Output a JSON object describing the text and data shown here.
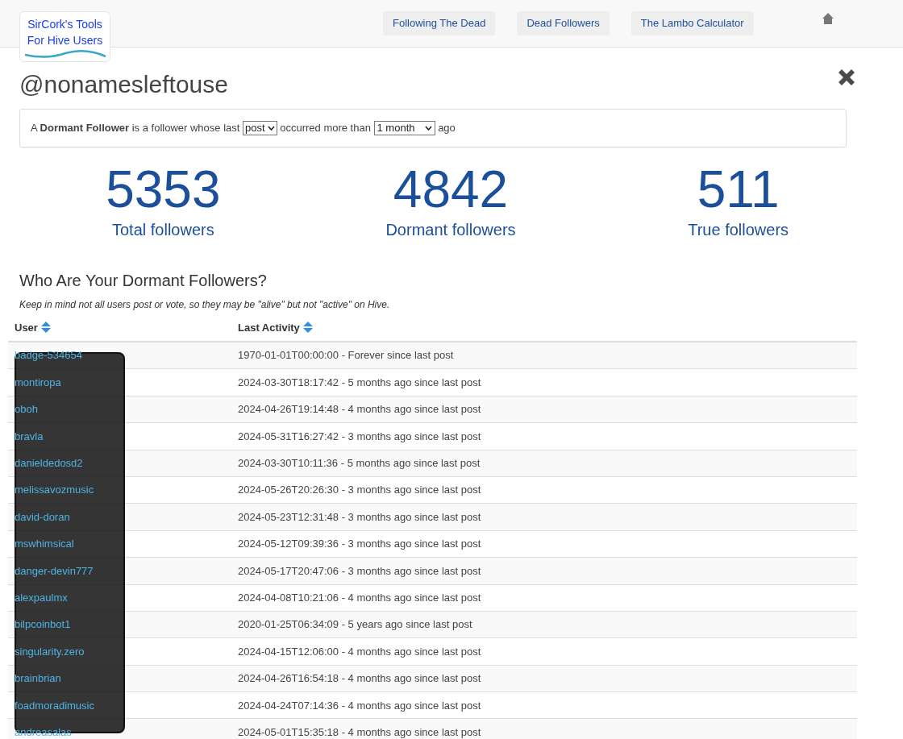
{
  "logo": {
    "line_1": "SirCork's Tools",
    "line_2": "For Hive Users"
  },
  "nav": [
    "Following The Dead",
    "Dead Followers",
    "The Lambo Calculator"
  ],
  "title": "@nonamesleftouse",
  "definition": {
    "prefix": "A ",
    "term": "Dormant Follower",
    "middle": " is a follower whose last ",
    "activity_select": "post",
    "after": " occurred more than ",
    "period_select": "1 month",
    "suffix": " ago"
  },
  "stats": [
    {
      "value": "5353",
      "label": "Total followers"
    },
    {
      "value": "4842",
      "label": "Dormant followers"
    },
    {
      "value": "511",
      "label": "True followers"
    }
  ],
  "section": {
    "heading": "Who Are Your Dormant Followers?",
    "note": "Keep in mind not all users post or vote, so they may be \"alive\" but not \"active\" on Hive."
  },
  "table": {
    "columns": [
      "User",
      "Last Activity"
    ],
    "rows": [
      {
        "user": "badge-534654",
        "activity": "1970-01-01T00:00:00 - Forever since last post"
      },
      {
        "user": "montiropa",
        "activity": "2024-03-30T18:17:42 - 5 months ago since last post"
      },
      {
        "user": "oboh",
        "activity": "2024-04-26T19:14:48 - 4 months ago since last post"
      },
      {
        "user": "bravla",
        "activity": "2024-05-31T16:27:42 - 3 months ago since last post"
      },
      {
        "user": "danieldedosd2",
        "activity": "2024-03-30T10:11:36 - 5 months ago since last post"
      },
      {
        "user": "melissavozmusic",
        "activity": "2024-05-26T20:26:30 - 3 months ago since last post"
      },
      {
        "user": "david-doran",
        "activity": "2024-05-23T12:31:48 - 3 months ago since last post"
      },
      {
        "user": "mswhimsical",
        "activity": "2024-05-12T09:39:36 - 3 months ago since last post"
      },
      {
        "user": "danger-devin777",
        "activity": "2024-05-17T20:47:06 - 3 months ago since last post"
      },
      {
        "user": "alexpaulmx",
        "activity": "2024-04-08T10:21:06 - 4 months ago since last post"
      },
      {
        "user": "bilpcoinbot1",
        "activity": "2020-01-25T06:34:09 - 5 years ago since last post"
      },
      {
        "user": "singularity.zero",
        "activity": "2024-04-15T12:06:00 - 4 months ago since last post"
      },
      {
        "user": "brainbrian",
        "activity": "2024-04-26T16:54:18 - 4 months ago since last post"
      },
      {
        "user": "foadmoradimusic",
        "activity": "2024-04-24T07:14:36 - 4 months ago since last post"
      },
      {
        "user": "andreasalas",
        "activity": "2024-05-01T15:35:18 - 4 months ago since last post"
      }
    ]
  }
}
